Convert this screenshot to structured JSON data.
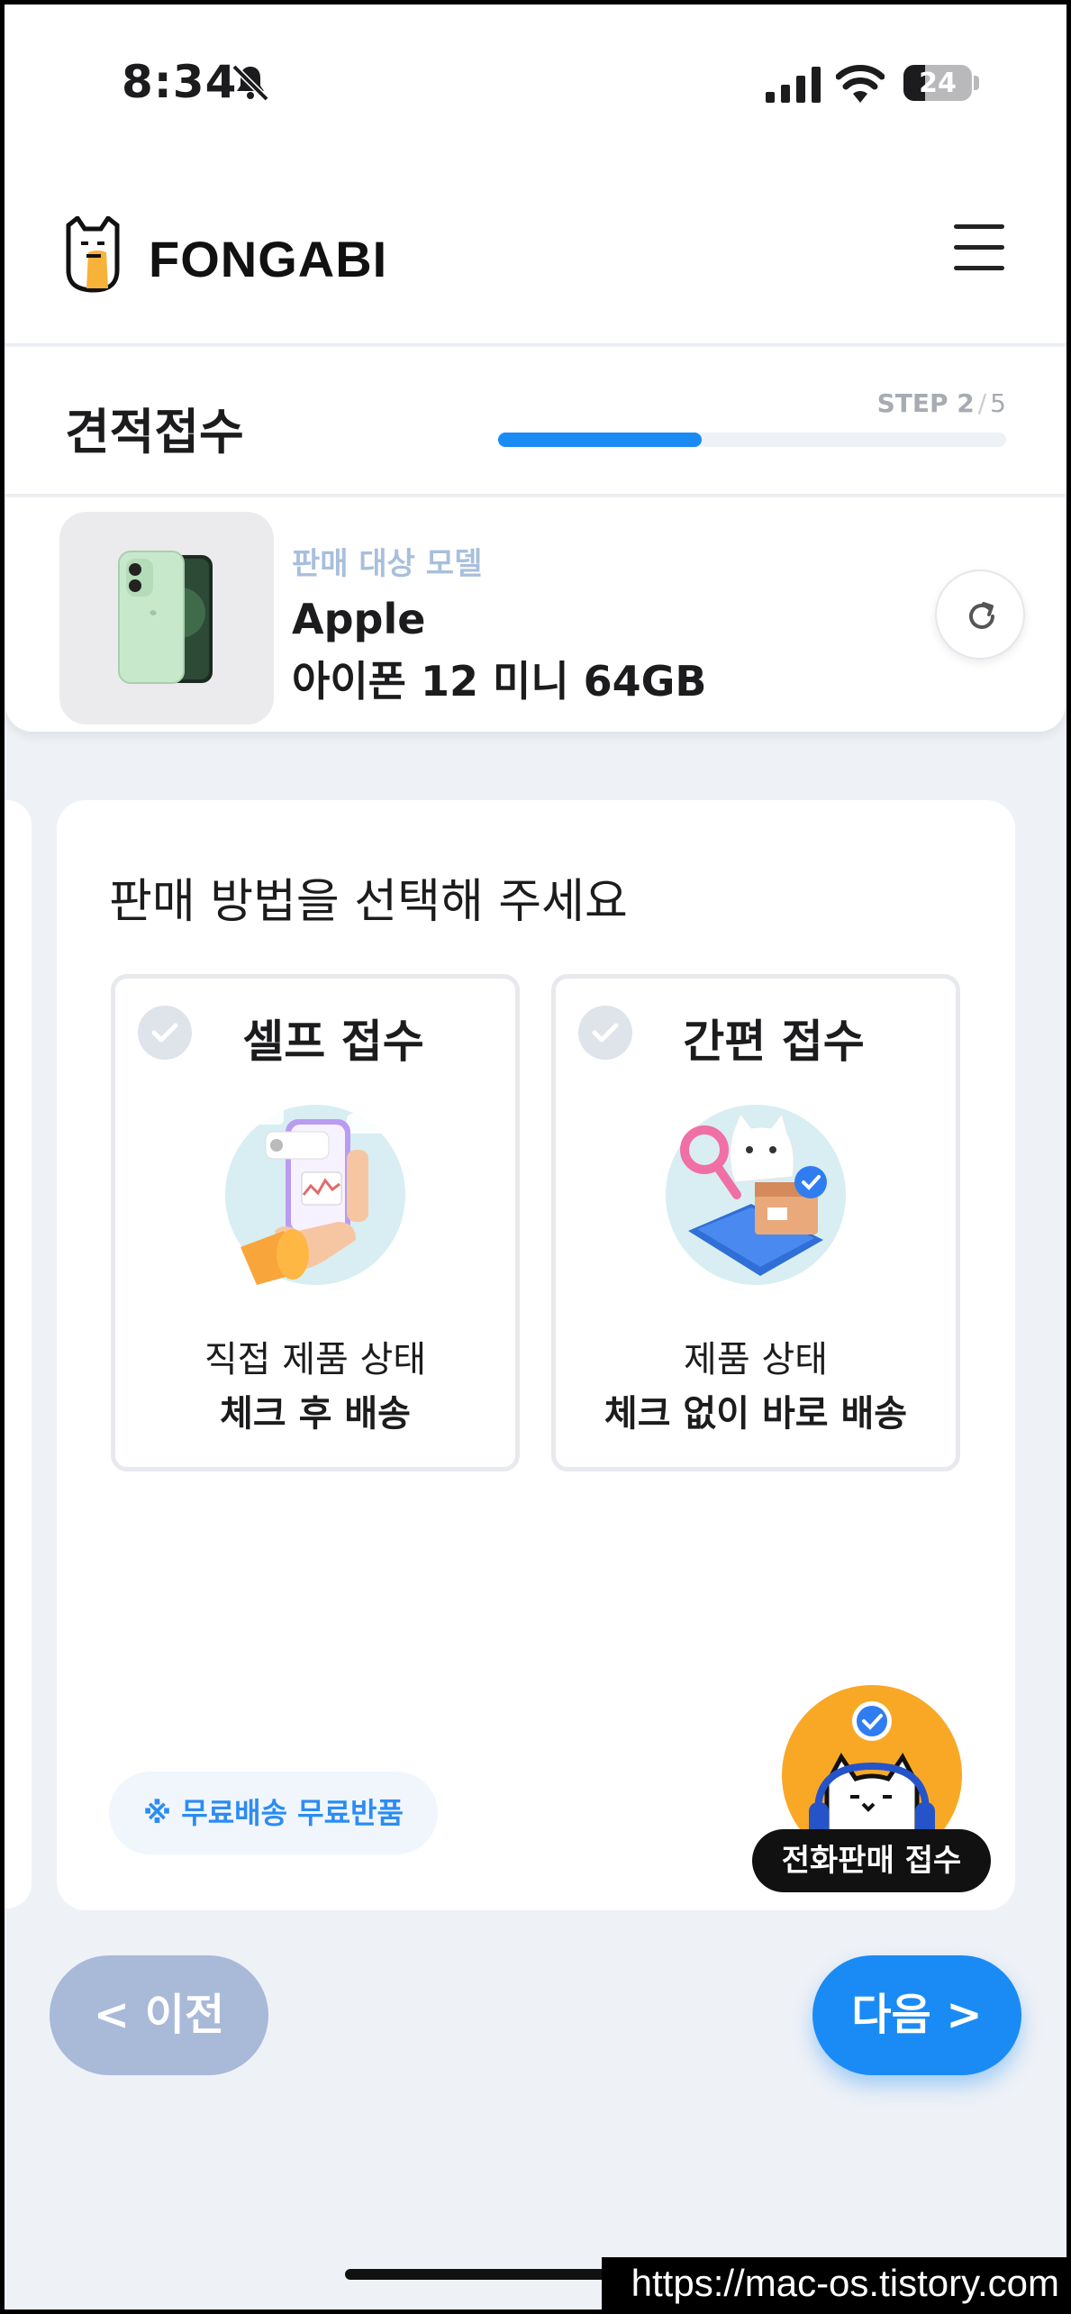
{
  "status_bar": {
    "time": "8:34",
    "battery": "24",
    "battery_level": 0.24,
    "icons": [
      "bell-muted-icon",
      "signal-icon",
      "wifi-icon",
      "battery-icon"
    ]
  },
  "header": {
    "brand": "FONGABI",
    "logo_icon": "cat-logo-icon",
    "menu_icon": "hamburger-menu-icon"
  },
  "step": {
    "title": "견적접수",
    "label": "STEP",
    "current": "2",
    "separator": "/",
    "total": "5",
    "progress": 0.4,
    "accent_color": "#1a8bf5"
  },
  "model": {
    "caption": "판매 대상 모델",
    "brand": "Apple",
    "name": "아이폰 12 미니 64GB",
    "refresh_icon": "refresh-icon"
  },
  "sale_method": {
    "question": "판매 방법을 선택해 주세요",
    "options": [
      {
        "title": "셀프 접수",
        "desc": "직접 제품 상태",
        "desc_bold": "체크 후 배송",
        "icon": "hand-phone-illustration"
      },
      {
        "title": "간편 접수",
        "desc": "제품 상태",
        "desc_bold": "체크 없이 바로 배송",
        "icon": "cat-box-illustration"
      }
    ],
    "badge": "※ 무료배송 무료반품"
  },
  "call_fab": {
    "label": "전화판매 접수",
    "icon": "cat-headset-icon"
  },
  "nav": {
    "prev": "< 이전",
    "next": "다음 >"
  },
  "watermark": "https://mac-os.tistory.com"
}
